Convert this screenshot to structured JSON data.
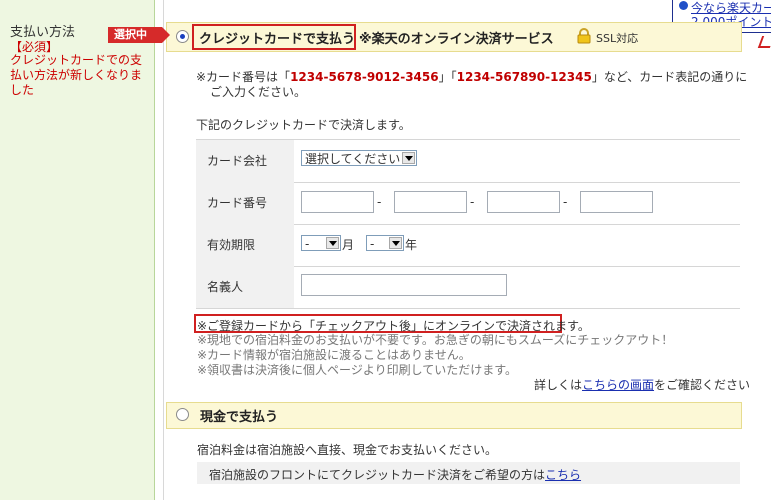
{
  "sidebar": {
    "title": "支払い方法",
    "required": "【必須】",
    "note": "クレジットカードでの支払い方法が新しくなりました"
  },
  "promo": {
    "line1": "今なら楽天カー",
    "line2": "2,000ポイントプ"
  },
  "credit_option": {
    "badge": "選択中",
    "label": "クレジットカードで支払う",
    "service": "※楽天のオンライン決済サービス",
    "ssl": "SSL対応",
    "note_prefix": "※カード番号は「",
    "example1": "1234-5678-9012-3456",
    "note_mid": "」「",
    "example2": "1234-567890-12345",
    "note_suffix": "」など、カード表記の通りに",
    "note_line2": "ご入力ください。",
    "decide_text": "下記のクレジットカードで決済します。",
    "form": {
      "card_company_label": "カード会社",
      "card_company_value": "選択してください",
      "card_number_label": "カード番号",
      "dash": "-",
      "expiry_label": "有効期限",
      "month_value": "-",
      "month_unit": "月",
      "year_value": "-",
      "year_unit": "年",
      "holder_label": "名義人"
    },
    "registered_note": "※ご登録カードから「チェックアウト後」にオンラインで決済されます。",
    "fine_notes": [
      "※現地での宿泊料金のお支払いが不要です。お急ぎの朝にもスムーズにチェックアウト！",
      "※カード情報が宿泊施設に渡ることはありません。",
      "※領収書は決済後に個人ページより印刷していただけます。"
    ],
    "more_info_prefix": "詳しくは",
    "more_info_link": "こちらの画面",
    "more_info_suffix": "をご確認ください"
  },
  "cash_option": {
    "label": "現金で支払う",
    "text": "宿泊料金は宿泊施設へ直接、現金でお支払いください。",
    "front_prefix": "宿泊施設のフロントにてクレジットカード決済をご希望の方は",
    "front_link": "こちら"
  }
}
